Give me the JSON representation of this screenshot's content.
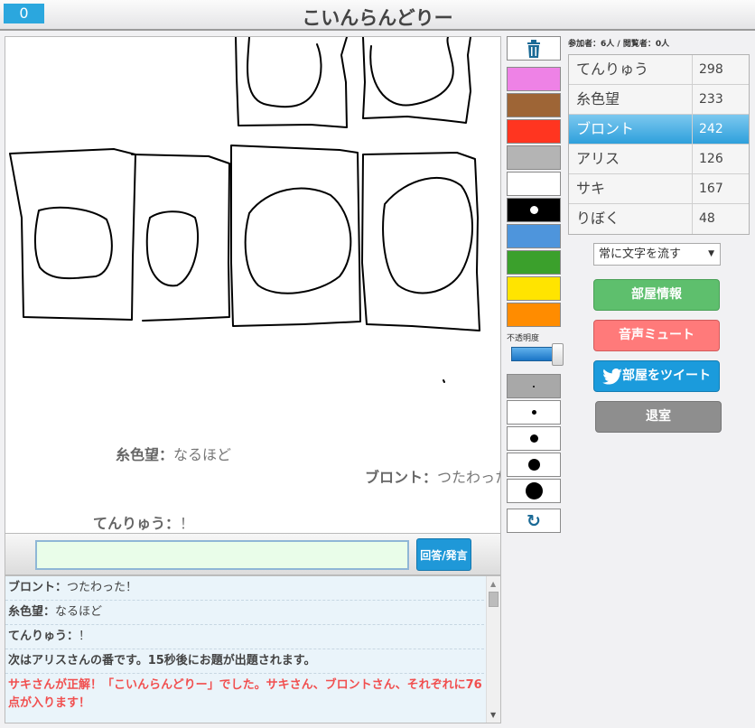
{
  "header": {
    "counter": "0",
    "title": "こいんらんどりー"
  },
  "canvas": {
    "flow_messages": [
      {
        "name": "糸色望：",
        "text": "なるほど"
      },
      {
        "name": "ブロント：",
        "text": "つたわった"
      },
      {
        "name": "てんりゅう：",
        "text": "！"
      }
    ]
  },
  "input": {
    "value": "",
    "send_label": "回答/発言"
  },
  "log": [
    {
      "name": "ブロント：",
      "text": "つたわった！"
    },
    {
      "name": "糸色望：",
      "text": "なるほど"
    },
    {
      "name": "てんりゅう：",
      "text": "！"
    },
    {
      "text": "次はアリスさんの番です。15秒後にお題が出題されます。"
    },
    {
      "text": "サキさんが正解！「こいんらんどりー」でした。サキさん、ブロントさん、それぞれに76点が入ります！"
    }
  ],
  "tools": {
    "colors": [
      "#ee82e6",
      "#9e6536",
      "#ff3520",
      "#b4b4b4",
      "#ffffff",
      "#000000",
      "#4e95dc",
      "#3ba02c",
      "#ffe400",
      "#ff8c00"
    ],
    "opacity_label": "不透明度",
    "opacity_value": 1.0
  },
  "side": {
    "participants_label": "参加者：6人 / 閲覧者：0人",
    "players": [
      {
        "name": "てんりゅう",
        "score": "298"
      },
      {
        "name": "糸色望",
        "score": "233"
      },
      {
        "name": "ブロント",
        "score": "242",
        "active": true
      },
      {
        "name": "アリス",
        "score": "126"
      },
      {
        "name": "サキ",
        "score": "167"
      },
      {
        "name": "りぼく",
        "score": "48"
      }
    ],
    "flow_option": "常に文字を流す",
    "room_info": "部屋情報",
    "mute": "音声ミュート",
    "tweet": "部屋をツイート",
    "leave": "退室"
  }
}
